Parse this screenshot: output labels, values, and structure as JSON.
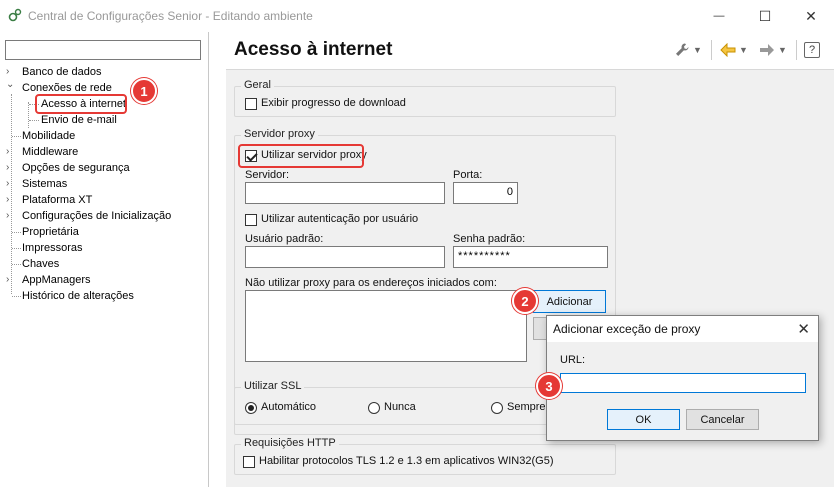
{
  "window": {
    "title": "Central de Configurações Senior - Editando ambiente",
    "controls": {
      "minimize": "—",
      "maximize": "☐",
      "close": "✕"
    }
  },
  "search": {
    "placeholder": "",
    "value": ""
  },
  "tree": {
    "items": [
      {
        "label": "Banco de dados",
        "expander": "›"
      },
      {
        "label": "Conexões de rede",
        "expander": "⌄"
      },
      {
        "label": "Acesso à internet",
        "expander": ""
      },
      {
        "label": "Envio de e-mail",
        "expander": ""
      },
      {
        "label": "Mobilidade",
        "expander": ""
      },
      {
        "label": "Middleware",
        "expander": "›"
      },
      {
        "label": "Opções de segurança",
        "expander": "›"
      },
      {
        "label": "Sistemas",
        "expander": "›"
      },
      {
        "label": "Plataforma XT",
        "expander": "›"
      },
      {
        "label": "Configurações de Inicialização",
        "expander": "›"
      },
      {
        "label": "Proprietária",
        "expander": ""
      },
      {
        "label": "Impressoras",
        "expander": ""
      },
      {
        "label": "Chaves",
        "expander": ""
      },
      {
        "label": "AppManagers",
        "expander": "›"
      },
      {
        "label": "Histórico de alterações",
        "expander": ""
      }
    ]
  },
  "page": {
    "title": "Acesso à internet"
  },
  "toolbar": {
    "tools_icon": "wrench-icon",
    "back_icon": "arrow-left-icon",
    "forward_icon": "arrow-right-icon",
    "help_label": "?",
    "accent_color": "#e8a317"
  },
  "geral": {
    "label": "Geral",
    "show_download_progress": {
      "label": "Exibir progresso de download",
      "checked": false
    }
  },
  "proxy": {
    "label": "Servidor proxy",
    "use_proxy": {
      "label": "Utilizar servidor proxy",
      "checked": true
    },
    "server_label": "Servidor:",
    "server_value": "",
    "port_label": "Porta:",
    "port_value": "0",
    "use_auth": {
      "label": "Utilizar autenticação por usuário",
      "checked": false
    },
    "user_label": "Usuário padrão:",
    "user_value": "",
    "password_label": "Senha padrão:",
    "password_value": "**********",
    "exceptions_label": "Não utilizar proxy para os endereços iniciados com:",
    "add_button": "Adicionar"
  },
  "ssl": {
    "label": "Utilizar SSL",
    "options": [
      "Automático",
      "Nunca",
      "Sempre"
    ],
    "selected": "Automático"
  },
  "http": {
    "label": "Requisições HTTP",
    "tls": {
      "label": "Habilitar protocolos TLS 1.2 e 1.3 em aplicativos WIN32(G5)",
      "checked": false
    }
  },
  "dialog": {
    "title": "Adicionar exceção de proxy",
    "url_label": "URL:",
    "url_value": "",
    "ok_label": "OK",
    "cancel_label": "Cancelar"
  },
  "annotations": {
    "step1": "1",
    "step2": "2",
    "step3": "3",
    "color": "#e53935"
  }
}
